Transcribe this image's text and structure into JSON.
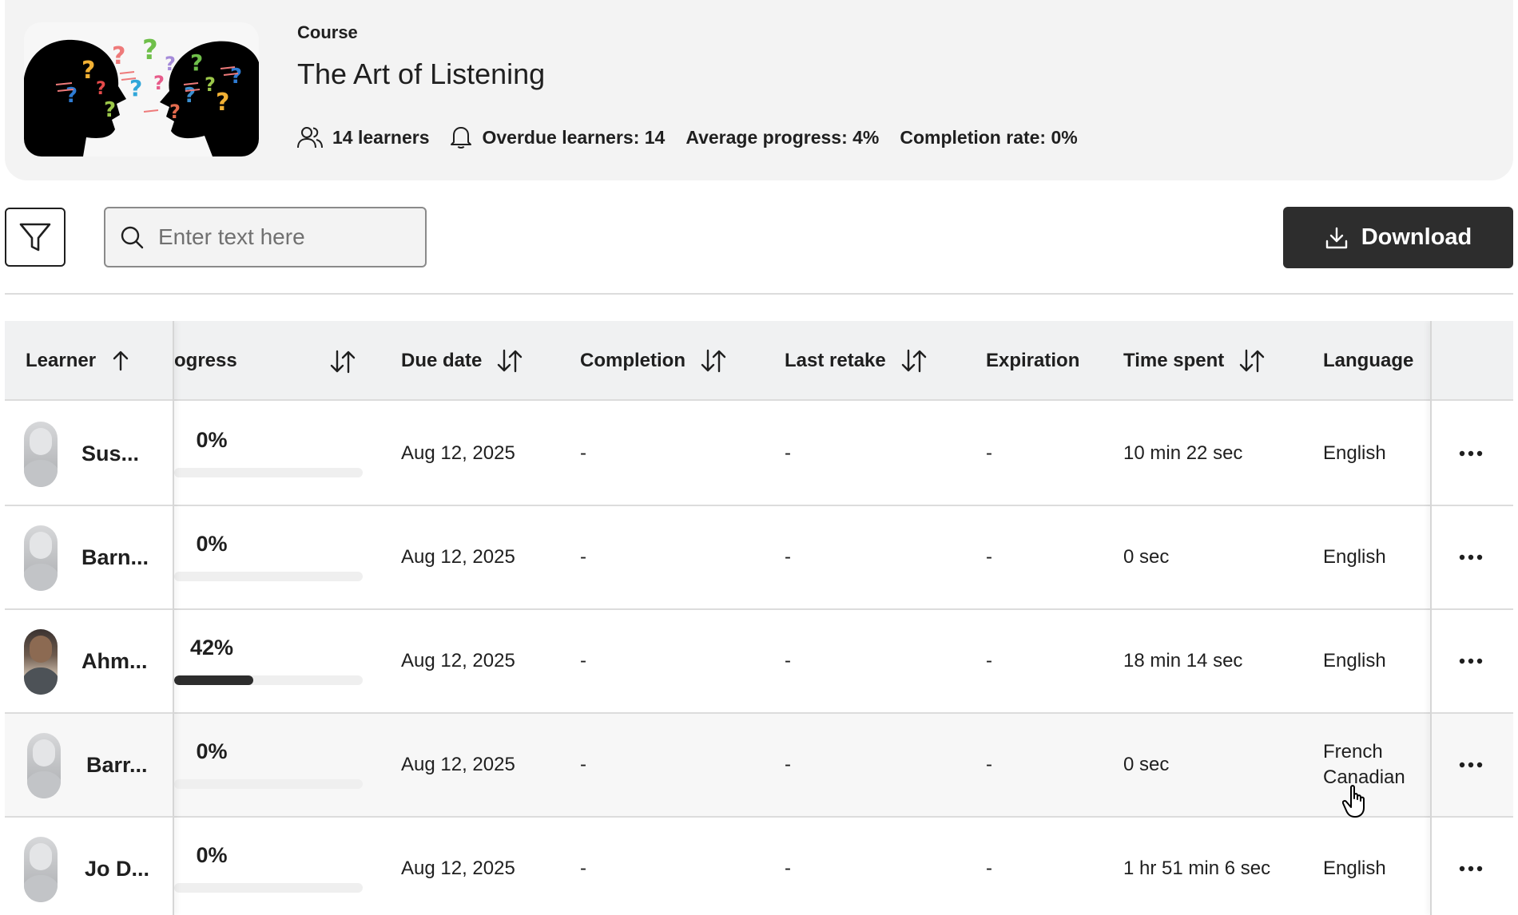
{
  "course": {
    "label": "Course",
    "title": "The Art of Listening",
    "stats": {
      "learners": "14 learners",
      "overdue": "Overdue learners: 14",
      "avg_progress": "Average progress: 4%",
      "completion_rate": "Completion rate: 0%"
    }
  },
  "toolbar": {
    "search_placeholder": "Enter text here",
    "search_value": "",
    "download_label": "Download"
  },
  "table": {
    "columns": {
      "learner": "Learner",
      "progress": "ogress",
      "due_date": "Due date",
      "completion": "Completion",
      "last_retake": "Last retake",
      "expiration": "Expiration",
      "time_spent": "Time spent",
      "language": "Language"
    },
    "rows": [
      {
        "name": "Sus...",
        "progress_label": "0%",
        "progress": 0,
        "due": "Aug 12, 2025",
        "completion": "-",
        "last_retake": "-",
        "expiration": "-",
        "time_spent": "10 min 22 sec",
        "language": "English"
      },
      {
        "name": "Barn...",
        "progress_label": "0%",
        "progress": 0,
        "due": "Aug 12, 2025",
        "completion": "-",
        "last_retake": "-",
        "expiration": "-",
        "time_spent": "0 sec",
        "language": "English"
      },
      {
        "name": "Ahm...",
        "progress_label": "42%",
        "progress": 42,
        "due": "Aug 12, 2025",
        "completion": "-",
        "last_retake": "-",
        "expiration": "-",
        "time_spent": "18 min 14 sec",
        "language": "English"
      },
      {
        "name": "Barr...",
        "progress_label": "0%",
        "progress": 0,
        "due": "Aug 12, 2025",
        "completion": "-",
        "last_retake": "-",
        "expiration": "-",
        "time_spent": "0 sec",
        "language": "French Canadian"
      },
      {
        "name": "Jo D...",
        "progress_label": "0%",
        "progress": 0,
        "due": "Aug 12, 2025",
        "completion": "-",
        "last_retake": "-",
        "expiration": "-",
        "time_spent": "1 hr 51 min 6 sec",
        "language": "English"
      }
    ]
  },
  "colors": {
    "header_bg": "#f3f3f3",
    "button_dark": "#2d2d2d",
    "progress_fill": "#2d2d2d",
    "table_header_bg": "#f0f1f2"
  }
}
